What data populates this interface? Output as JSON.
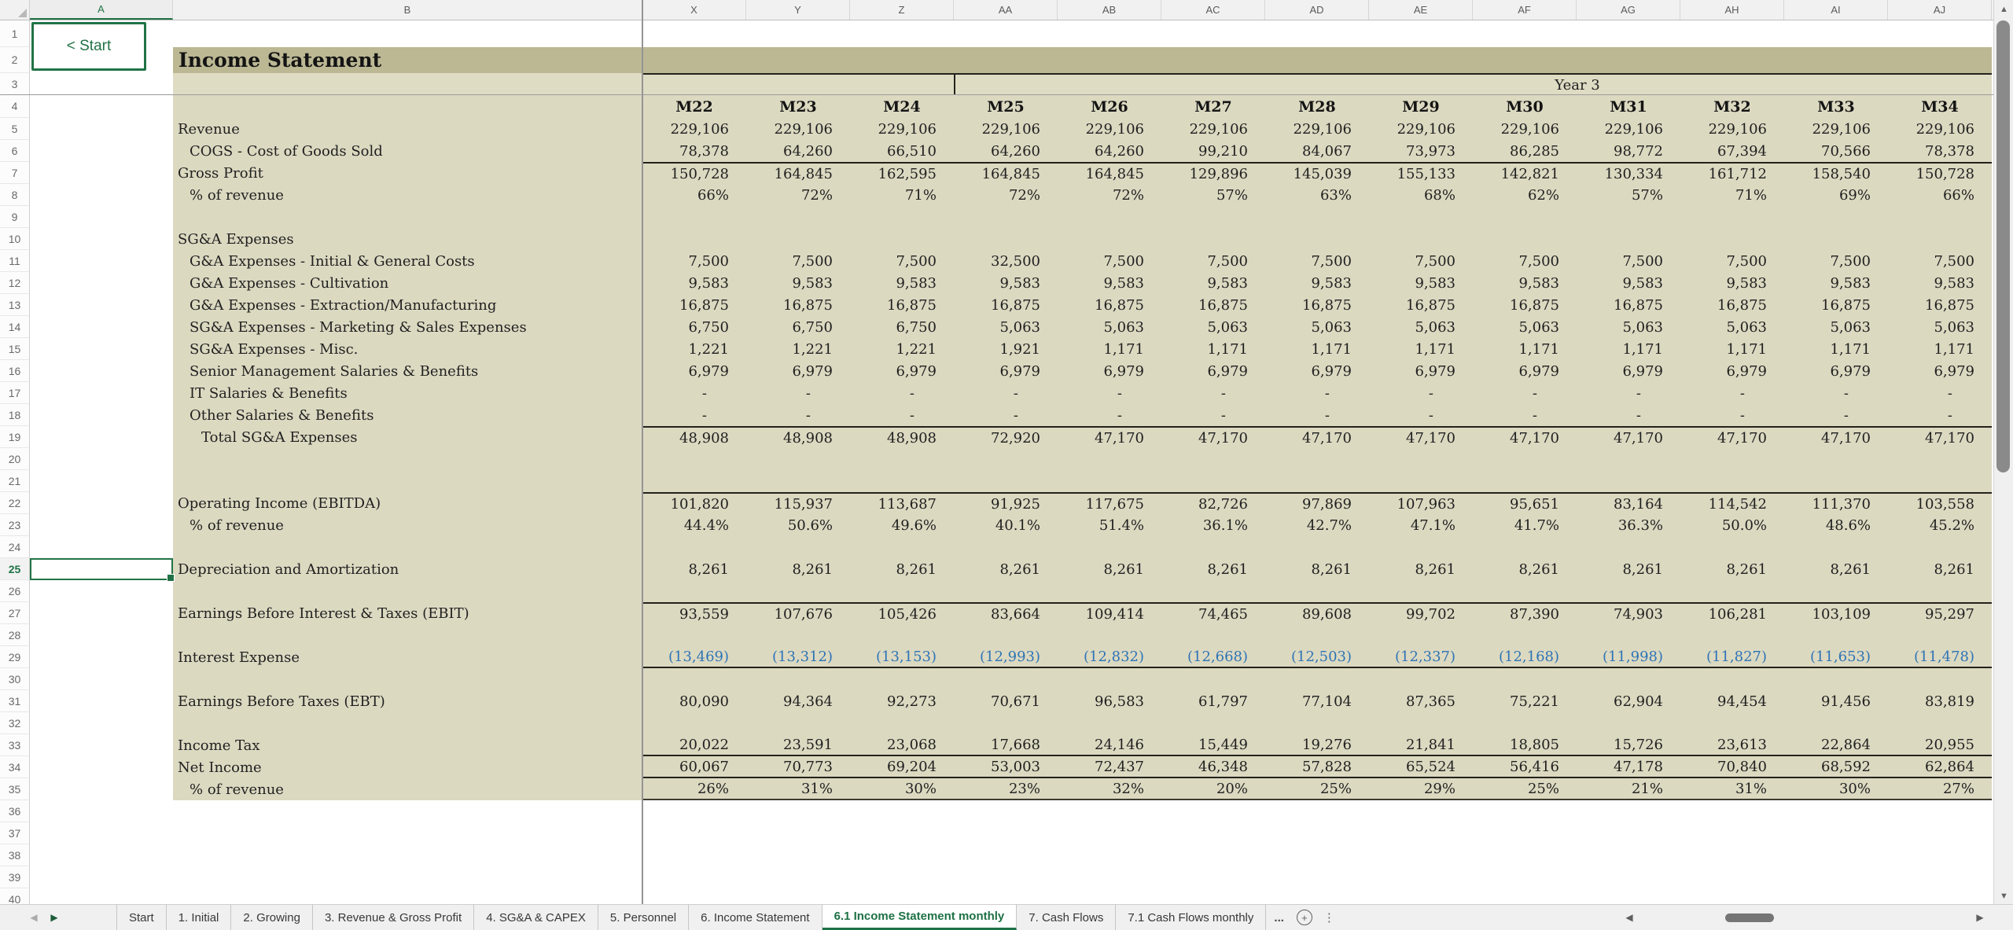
{
  "colors": {
    "accent_green": "#217346",
    "band_dark": "#bcb894",
    "band_light": "#dfdcc4",
    "table_bg": "#dcd9c1",
    "negative_blue": "#2e74b5"
  },
  "start_button": {
    "label": "< Start"
  },
  "column_headers": [
    "A",
    "B",
    "X",
    "Y",
    "Z",
    "AA",
    "AB",
    "AC",
    "AD",
    "AE",
    "AF",
    "AG",
    "AH",
    "AI",
    "AJ"
  ],
  "selection": {
    "column": "A",
    "row": 25,
    "cell": "A25"
  },
  "grid": {
    "first_row": 1,
    "last_row": 40
  },
  "sheet": {
    "title": "Income Statement",
    "year_band_label": "Year 3",
    "months": [
      "M22",
      "M23",
      "M24",
      "M25",
      "M26",
      "M27",
      "M28",
      "M29",
      "M30",
      "M31",
      "M32",
      "M33",
      "M34"
    ],
    "rows": [
      {
        "n": 5,
        "label": "Revenue",
        "indent": 0,
        "values": [
          "229,106",
          "229,106",
          "229,106",
          "229,106",
          "229,106",
          "229,106",
          "229,106",
          "229,106",
          "229,106",
          "229,106",
          "229,106",
          "229,106",
          "229,106"
        ]
      },
      {
        "n": 6,
        "label": "COGS - Cost of Goods Sold",
        "indent": 1,
        "values": [
          "78,378",
          "64,260",
          "66,510",
          "64,260",
          "64,260",
          "99,210",
          "84,067",
          "73,973",
          "86,285",
          "98,772",
          "67,394",
          "70,566",
          "78,378"
        ]
      },
      {
        "n": 7,
        "label": "Gross Profit",
        "indent": 0,
        "border_top": true,
        "values": [
          "150,728",
          "164,845",
          "162,595",
          "164,845",
          "164,845",
          "129,896",
          "145,039",
          "155,133",
          "142,821",
          "130,334",
          "161,712",
          "158,540",
          "150,728"
        ]
      },
      {
        "n": 8,
        "label": "% of revenue",
        "indent": 1,
        "values": [
          "66%",
          "72%",
          "71%",
          "72%",
          "72%",
          "57%",
          "63%",
          "68%",
          "62%",
          "57%",
          "71%",
          "69%",
          "66%"
        ]
      },
      {
        "n": 9
      },
      {
        "n": 10,
        "label": "SG&A Expenses",
        "indent": 0
      },
      {
        "n": 11,
        "label": "G&A Expenses - Initial & General Costs",
        "indent": 1,
        "values": [
          "7,500",
          "7,500",
          "7,500",
          "32,500",
          "7,500",
          "7,500",
          "7,500",
          "7,500",
          "7,500",
          "7,500",
          "7,500",
          "7,500",
          "7,500"
        ]
      },
      {
        "n": 12,
        "label": "G&A Expenses - Cultivation",
        "indent": 1,
        "values": [
          "9,583",
          "9,583",
          "9,583",
          "9,583",
          "9,583",
          "9,583",
          "9,583",
          "9,583",
          "9,583",
          "9,583",
          "9,583",
          "9,583",
          "9,583"
        ]
      },
      {
        "n": 13,
        "label": "G&A Expenses - Extraction/Manufacturing",
        "indent": 1,
        "values": [
          "16,875",
          "16,875",
          "16,875",
          "16,875",
          "16,875",
          "16,875",
          "16,875",
          "16,875",
          "16,875",
          "16,875",
          "16,875",
          "16,875",
          "16,875"
        ]
      },
      {
        "n": 14,
        "label": "SG&A Expenses - Marketing & Sales Expenses",
        "indent": 1,
        "values": [
          "6,750",
          "6,750",
          "6,750",
          "5,063",
          "5,063",
          "5,063",
          "5,063",
          "5,063",
          "5,063",
          "5,063",
          "5,063",
          "5,063",
          "5,063"
        ]
      },
      {
        "n": 15,
        "label": "SG&A Expenses - Misc.",
        "indent": 1,
        "values": [
          "1,221",
          "1,221",
          "1,221",
          "1,921",
          "1,171",
          "1,171",
          "1,171",
          "1,171",
          "1,171",
          "1,171",
          "1,171",
          "1,171",
          "1,171"
        ]
      },
      {
        "n": 16,
        "label": "Senior Management Salaries & Benefits",
        "indent": 1,
        "values": [
          "6,979",
          "6,979",
          "6,979",
          "6,979",
          "6,979",
          "6,979",
          "6,979",
          "6,979",
          "6,979",
          "6,979",
          "6,979",
          "6,979",
          "6,979"
        ]
      },
      {
        "n": 17,
        "label": "IT Salaries & Benefits",
        "indent": 1,
        "dash": true,
        "values": [
          "-",
          "-",
          "-",
          "-",
          "-",
          "-",
          "-",
          "-",
          "-",
          "-",
          "-",
          "-",
          "-"
        ]
      },
      {
        "n": 18,
        "label": "Other Salaries & Benefits",
        "indent": 1,
        "dash": true,
        "values": [
          "-",
          "-",
          "-",
          "-",
          "-",
          "-",
          "-",
          "-",
          "-",
          "-",
          "-",
          "-",
          "-"
        ]
      },
      {
        "n": 19,
        "label": "Total SG&A Expenses",
        "indent": 2,
        "border_top": true,
        "values": [
          "48,908",
          "48,908",
          "48,908",
          "72,920",
          "47,170",
          "47,170",
          "47,170",
          "47,170",
          "47,170",
          "47,170",
          "47,170",
          "47,170",
          "47,170"
        ]
      },
      {
        "n": 20
      },
      {
        "n": 21
      },
      {
        "n": 22,
        "label": "Operating Income (EBITDA)",
        "indent": 0,
        "border_top": true,
        "values": [
          "101,820",
          "115,937",
          "113,687",
          "91,925",
          "117,675",
          "82,726",
          "97,869",
          "107,963",
          "95,651",
          "83,164",
          "114,542",
          "111,370",
          "103,558"
        ]
      },
      {
        "n": 23,
        "label": "% of revenue",
        "indent": 1,
        "values": [
          "44.4%",
          "50.6%",
          "49.6%",
          "40.1%",
          "51.4%",
          "36.1%",
          "42.7%",
          "47.1%",
          "41.7%",
          "36.3%",
          "50.0%",
          "48.6%",
          "45.2%"
        ]
      },
      {
        "n": 24
      },
      {
        "n": 25,
        "label": "Depreciation and Amortization",
        "indent": 0,
        "values": [
          "8,261",
          "8,261",
          "8,261",
          "8,261",
          "8,261",
          "8,261",
          "8,261",
          "8,261",
          "8,261",
          "8,261",
          "8,261",
          "8,261",
          "8,261"
        ]
      },
      {
        "n": 26
      },
      {
        "n": 27,
        "label": "Earnings Before Interest & Taxes (EBIT)",
        "indent": 0,
        "border_top": true,
        "values": [
          "93,559",
          "107,676",
          "105,426",
          "83,664",
          "109,414",
          "74,465",
          "89,608",
          "99,702",
          "87,390",
          "74,903",
          "106,281",
          "103,109",
          "95,297"
        ]
      },
      {
        "n": 28
      },
      {
        "n": 29,
        "label": "Interest Expense",
        "indent": 0,
        "blue": true,
        "border_bottom": true,
        "values": [
          "(13,469)",
          "(13,312)",
          "(13,153)",
          "(12,993)",
          "(12,832)",
          "(12,668)",
          "(12,503)",
          "(12,337)",
          "(12,168)",
          "(11,998)",
          "(11,827)",
          "(11,653)",
          "(11,478)"
        ]
      },
      {
        "n": 30
      },
      {
        "n": 31,
        "label": "Earnings Before Taxes (EBT)",
        "indent": 0,
        "values": [
          "80,090",
          "94,364",
          "92,273",
          "70,671",
          "96,583",
          "61,797",
          "77,104",
          "87,365",
          "75,221",
          "62,904",
          "94,454",
          "91,456",
          "83,819"
        ]
      },
      {
        "n": 32
      },
      {
        "n": 33,
        "label": "Income Tax",
        "indent": 0,
        "border_bottom": true,
        "values": [
          "20,022",
          "23,591",
          "23,068",
          "17,668",
          "24,146",
          "15,449",
          "19,276",
          "21,841",
          "18,805",
          "15,726",
          "23,613",
          "22,864",
          "20,955"
        ]
      },
      {
        "n": 34,
        "label": "Net Income",
        "indent": 0,
        "border_bottom": true,
        "values": [
          "60,067",
          "70,773",
          "69,204",
          "53,003",
          "72,437",
          "46,348",
          "57,828",
          "65,524",
          "56,416",
          "47,178",
          "70,840",
          "68,592",
          "62,864"
        ]
      },
      {
        "n": 35,
        "label": "% of revenue",
        "indent": 1,
        "table_end": true,
        "values": [
          "26%",
          "31%",
          "30%",
          "23%",
          "32%",
          "20%",
          "25%",
          "29%",
          "25%",
          "21%",
          "31%",
          "30%",
          "27%"
        ]
      },
      {
        "n": 36
      },
      {
        "n": 37
      },
      {
        "n": 38
      },
      {
        "n": 39
      },
      {
        "n": 40
      }
    ]
  },
  "tab_bar": {
    "nav_prev": "◀",
    "nav_next": "▶",
    "tabs": [
      {
        "label": "Start",
        "active": false
      },
      {
        "label": "1. Initial",
        "active": false
      },
      {
        "label": "2. Growing",
        "active": false
      },
      {
        "label": "3. Revenue & Gross Profit",
        "active": false
      },
      {
        "label": "4. SG&A & CAPEX",
        "active": false
      },
      {
        "label": "5. Personnel",
        "active": false
      },
      {
        "label": "6. Income Statement",
        "active": false
      },
      {
        "label": "6.1 Income Statement monthly",
        "active": true
      },
      {
        "label": "7. Cash Flows",
        "active": false
      },
      {
        "label": "7.1 Cash Flows monthly",
        "active": false
      }
    ],
    "more_indicator": "...",
    "add_sheet_label": "+",
    "overflow_label": "⋮"
  },
  "icons": {
    "up_arrow": "▲",
    "down_arrow": "▼",
    "left_arrow": "◀",
    "right_arrow": "▶"
  }
}
